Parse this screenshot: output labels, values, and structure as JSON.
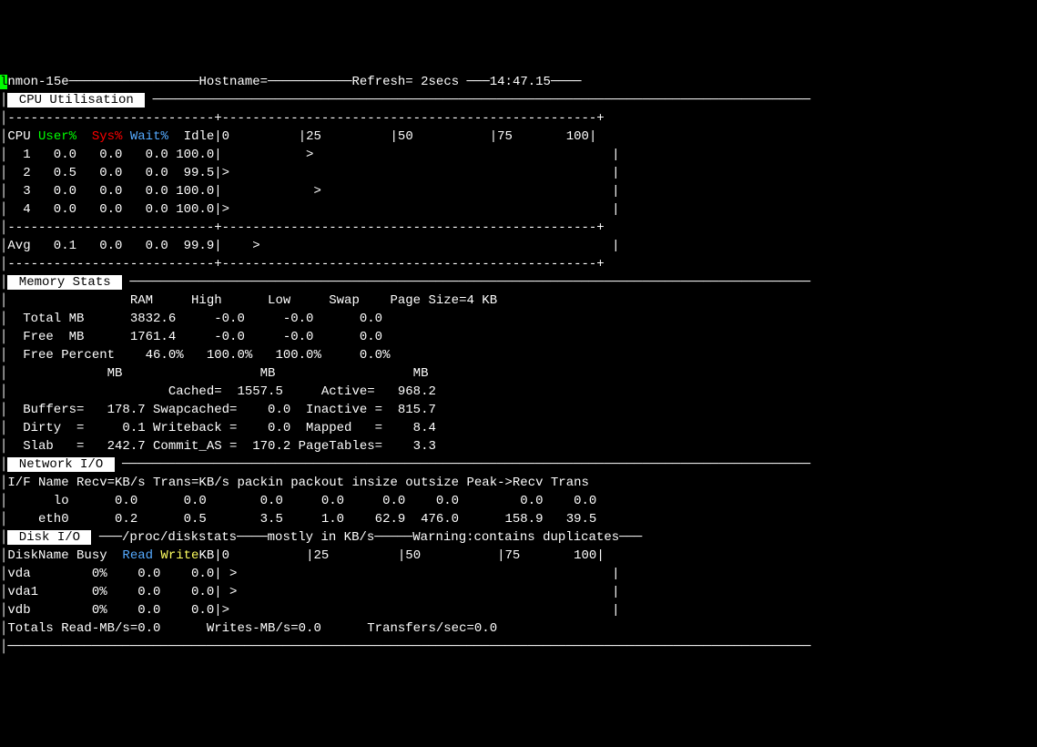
{
  "header": {
    "program": "nmon-15e",
    "hostname_label": "Hostname=",
    "refresh": "Refresh= 2secs",
    "time": "14:47.15"
  },
  "cpu": {
    "title": " CPU Utilisation ",
    "hdr_cpu": "CPU",
    "hdr_user": "User%",
    "hdr_sys": "Sys%",
    "hdr_wait": "Wait%",
    "hdr_idle": "Idle",
    "scale": "0         |25         |50          |75       100|",
    "rows": [
      {
        "id": "  1",
        "u": "  0.0",
        "s": "  0.0",
        "w": "  0.0",
        "idle": "100.0",
        "bar": "|           >                                       |"
      },
      {
        "id": "  2",
        "u": "  0.5",
        "s": "  0.0",
        "w": "  0.0",
        "idle": " 99.5",
        "bar": "|>                                                  |"
      },
      {
        "id": "  3",
        "u": "  0.0",
        "s": "  0.0",
        "w": "  0.0",
        "idle": "100.0",
        "bar": "|            >                                      |"
      },
      {
        "id": "  4",
        "u": "  0.0",
        "s": "  0.0",
        "w": "  0.0",
        "idle": "100.0",
        "bar": "|>                                                  |"
      }
    ],
    "avg": {
      "id": "Avg",
      "u": "  0.1",
      "s": "  0.0",
      "w": "  0.0",
      "idle": " 99.9",
      "bar": "|    >                                              |"
    }
  },
  "mem": {
    "title": " Memory Stats ",
    "hdr": "                RAM     High      Low     Swap    Page Size=4 KB",
    "total": "  Total MB      3832.6     -0.0     -0.0      0.0",
    "free": "  Free  MB      1761.4     -0.0     -0.0      0.0",
    "pct": "  Free Percent    46.0%   100.0%   100.0%     0.0%",
    "mbhdr": "             MB                  MB                  MB",
    "l1": "                     Cached=  1557.5     Active=   968.2",
    "l2": "  Buffers=   178.7 Swapcached=    0.0  Inactive =  815.7",
    "l3": "  Dirty  =     0.1 Writeback =    0.0  Mapped   =    8.4",
    "l4": "  Slab   =   242.7 Commit_AS =  170.2 PageTables=    3.3"
  },
  "net": {
    "title": " Network I/O ",
    "hdr": "I/F Name Recv=KB/s Trans=KB/s packin packout insize outsize Peak->Recv Trans",
    "rows": [
      "      lo      0.0      0.0       0.0     0.0     0.0    0.0        0.0    0.0",
      "    eth0      0.2      0.5       3.5     1.0    62.9  476.0      158.9   39.5"
    ]
  },
  "disk": {
    "title": " Disk I/O ",
    "subtitle": "/proc/diskstats",
    "note": "mostly in KB/s",
    "warn": "Warning:contains duplicates",
    "hdr_name": "DiskName Busy  ",
    "hdr_read": "Read",
    "hdr_write": " Write",
    "hdr_scale": "KB|0          |25         |50          |75       100|",
    "rows": [
      "vda        0%    0.0    0.0| >                                                 |",
      "vda1       0%    0.0    0.0| >                                                 |",
      "vdb        0%    0.0    0.0|>                                                  |"
    ],
    "totals": "Totals Read-MB/s=0.0      Writes-MB/s=0.0      Transfers/sec=0.0"
  },
  "chart_data": [
    {
      "type": "table",
      "title": "CPU Utilisation",
      "columns": [
        "CPU",
        "User%",
        "Sys%",
        "Wait%",
        "Idle"
      ],
      "rows": [
        [
          "1",
          0.0,
          0.0,
          0.0,
          100.0
        ],
        [
          "2",
          0.5,
          0.0,
          0.0,
          99.5
        ],
        [
          "3",
          0.0,
          0.0,
          0.0,
          100.0
        ],
        [
          "4",
          0.0,
          0.0,
          0.0,
          100.0
        ],
        [
          "Avg",
          0.1,
          0.0,
          0.0,
          99.9
        ]
      ]
    },
    {
      "type": "table",
      "title": "Memory Stats",
      "columns": [
        "",
        "RAM",
        "High",
        "Low",
        "Swap"
      ],
      "rows": [
        [
          "Total MB",
          3832.6,
          -0.0,
          -0.0,
          0.0
        ],
        [
          "Free MB",
          1761.4,
          -0.0,
          -0.0,
          0.0
        ],
        [
          "Free Percent",
          "46.0%",
          "100.0%",
          "100.0%",
          "0.0%"
        ]
      ],
      "extra": {
        "Page Size": "4 KB",
        "Cached": 1557.5,
        "Active": 968.2,
        "Buffers": 178.7,
        "Swapcached": 0.0,
        "Inactive": 815.7,
        "Dirty": 0.1,
        "Writeback": 0.0,
        "Mapped": 8.4,
        "Slab": 242.7,
        "Commit_AS": 170.2,
        "PageTables": 3.3
      }
    },
    {
      "type": "table",
      "title": "Network I/O",
      "columns": [
        "I/F Name",
        "Recv=KB/s",
        "Trans=KB/s",
        "packin",
        "packout",
        "insize",
        "outsize",
        "Peak->Recv",
        "Trans"
      ],
      "rows": [
        [
          "lo",
          0.0,
          0.0,
          0.0,
          0.0,
          0.0,
          0.0,
          0.0,
          0.0
        ],
        [
          "eth0",
          0.2,
          0.5,
          3.5,
          1.0,
          62.9,
          476.0,
          158.9,
          39.5
        ]
      ]
    },
    {
      "type": "table",
      "title": "Disk I/O",
      "columns": [
        "DiskName",
        "Busy",
        "Read",
        "Write"
      ],
      "rows": [
        [
          "vda",
          "0%",
          0.0,
          0.0
        ],
        [
          "vda1",
          "0%",
          0.0,
          0.0
        ],
        [
          "vdb",
          "0%",
          0.0,
          0.0
        ]
      ],
      "totals": {
        "Read-MB/s": 0.0,
        "Writes-MB/s": 0.0,
        "Transfers/sec": 0.0
      }
    }
  ]
}
